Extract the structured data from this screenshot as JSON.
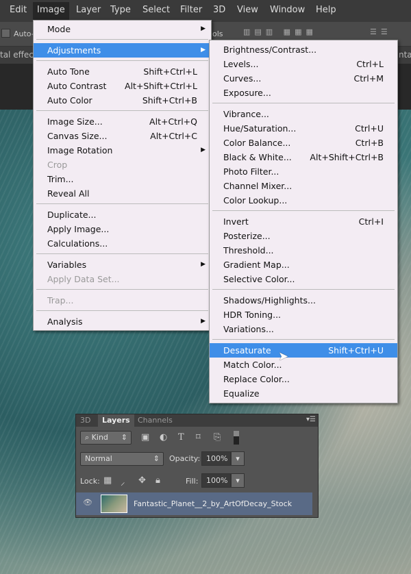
{
  "menubar": {
    "items": [
      "Edit",
      "Image",
      "Layer",
      "Type",
      "Select",
      "Filter",
      "3D",
      "View",
      "Window",
      "Help"
    ],
    "active": "Image"
  },
  "options_bar": {
    "auto_label": "Auto-",
    "tools_fragment": "ols"
  },
  "tab_bar": {
    "left_fragment": "tal effect",
    "right_fragment": "nta"
  },
  "image_menu": [
    {
      "label": "Mode",
      "submenu": true
    },
    {
      "sep": true
    },
    {
      "label": "Adjustments",
      "submenu": true,
      "highlighted": true
    },
    {
      "sep": true
    },
    {
      "label": "Auto Tone",
      "shortcut": "Shift+Ctrl+L"
    },
    {
      "label": "Auto Contrast",
      "shortcut": "Alt+Shift+Ctrl+L"
    },
    {
      "label": "Auto Color",
      "shortcut": "Shift+Ctrl+B"
    },
    {
      "sep": true
    },
    {
      "label": "Image Size...",
      "shortcut": "Alt+Ctrl+Q"
    },
    {
      "label": "Canvas Size...",
      "shortcut": "Alt+Ctrl+C"
    },
    {
      "label": "Image Rotation",
      "submenu": true
    },
    {
      "label": "Crop",
      "disabled": true
    },
    {
      "label": "Trim..."
    },
    {
      "label": "Reveal All"
    },
    {
      "sep": true
    },
    {
      "label": "Duplicate..."
    },
    {
      "label": "Apply Image..."
    },
    {
      "label": "Calculations..."
    },
    {
      "sep": true
    },
    {
      "label": "Variables",
      "submenu": true
    },
    {
      "label": "Apply Data Set...",
      "disabled": true
    },
    {
      "sep": true
    },
    {
      "label": "Trap...",
      "disabled": true
    },
    {
      "sep": true
    },
    {
      "label": "Analysis",
      "submenu": true
    }
  ],
  "adjustments_menu": [
    {
      "label": "Brightness/Contrast..."
    },
    {
      "label": "Levels...",
      "shortcut": "Ctrl+L"
    },
    {
      "label": "Curves...",
      "shortcut": "Ctrl+M"
    },
    {
      "label": "Exposure..."
    },
    {
      "sep": true
    },
    {
      "label": "Vibrance..."
    },
    {
      "label": "Hue/Saturation...",
      "shortcut": "Ctrl+U"
    },
    {
      "label": "Color Balance...",
      "shortcut": "Ctrl+B"
    },
    {
      "label": "Black & White...",
      "shortcut": "Alt+Shift+Ctrl+B"
    },
    {
      "label": "Photo Filter..."
    },
    {
      "label": "Channel Mixer..."
    },
    {
      "label": "Color Lookup..."
    },
    {
      "sep": true
    },
    {
      "label": "Invert",
      "shortcut": "Ctrl+I"
    },
    {
      "label": "Posterize..."
    },
    {
      "label": "Threshold..."
    },
    {
      "label": "Gradient Map..."
    },
    {
      "label": "Selective Color..."
    },
    {
      "sep": true
    },
    {
      "label": "Shadows/Highlights..."
    },
    {
      "label": "HDR Toning..."
    },
    {
      "label": "Variations..."
    },
    {
      "sep": true
    },
    {
      "label": "Desaturate",
      "shortcut": "Shift+Ctrl+U",
      "highlighted": true
    },
    {
      "label": "Match Color..."
    },
    {
      "label": "Replace Color..."
    },
    {
      "label": "Equalize"
    }
  ],
  "layers_panel": {
    "tabs": [
      "3D",
      "Layers",
      "Channels"
    ],
    "active_tab": "Layers",
    "filter_kind": "Kind",
    "blend_mode": "Normal",
    "opacity_label": "Opacity:",
    "opacity": "100%",
    "lock_label": "Lock:",
    "fill_label": "Fill:",
    "fill": "100%",
    "layer_name": "Fantastic_Planet__2_by_ArtOfDecay_Stock"
  },
  "colors": {
    "highlight": "#3f8ee8",
    "menu_bg": "#f3ecf3"
  }
}
